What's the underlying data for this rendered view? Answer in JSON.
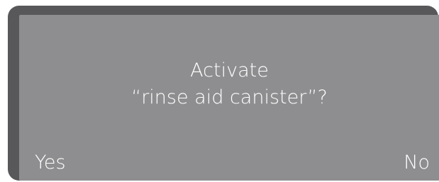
{
  "colors": {
    "frame": "#58585a",
    "screen": "#8e8e90",
    "text": "#ffffff"
  },
  "dialog": {
    "line1": "Activate",
    "line2": "“rinse aid canister”?"
  },
  "softkeys": {
    "yes_label": "Yes",
    "no_label": "No"
  }
}
